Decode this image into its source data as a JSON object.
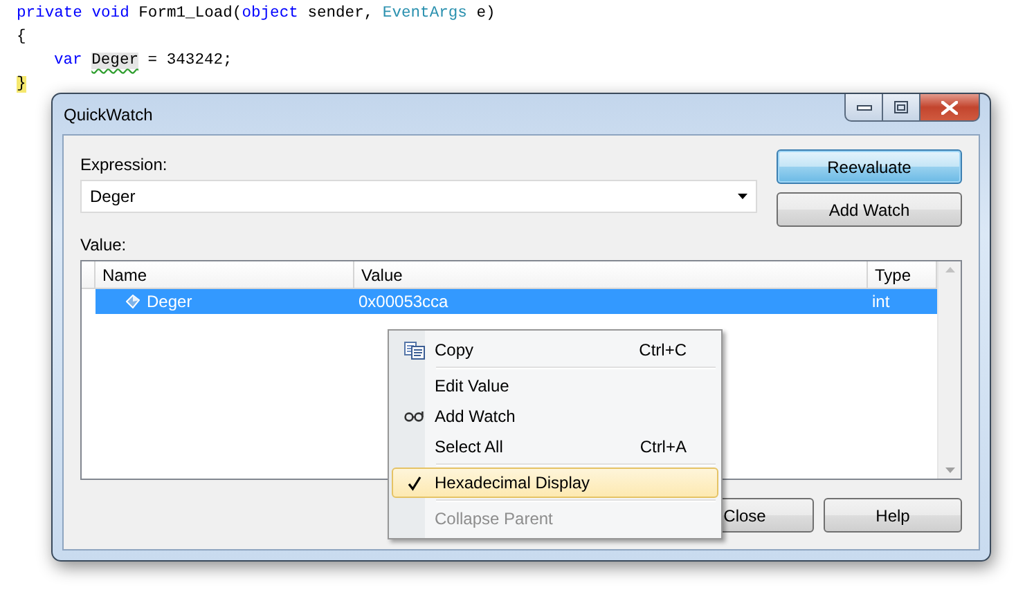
{
  "editor": {
    "lines": [
      {
        "tokens": [
          {
            "kind": "keyword",
            "text": "private "
          },
          {
            "kind": "keyword",
            "text": "void "
          },
          {
            "kind": "plain",
            "text": "Form1_Load("
          },
          {
            "kind": "keyword",
            "text": "object "
          },
          {
            "kind": "plain",
            "text": "sender, "
          },
          {
            "kind": "type",
            "text": "EventArgs "
          },
          {
            "kind": "plain",
            "text": "e)"
          }
        ]
      },
      {
        "tokens": [
          {
            "kind": "plain",
            "text": "{"
          }
        ]
      },
      {
        "indented": true,
        "tokens": [
          {
            "kind": "keyword",
            "text": "var "
          },
          {
            "kind": "warning",
            "text": "Deger"
          },
          {
            "kind": "plain",
            "text": " = 343242;"
          }
        ]
      },
      {
        "tokens": [
          {
            "kind": "brace-match",
            "text": "}"
          }
        ]
      }
    ]
  },
  "dialog": {
    "title": "QuickWatch",
    "expression": {
      "label": "Expression:",
      "value": "Deger"
    },
    "buttons": [
      {
        "label": "Reevaluate",
        "default": true
      },
      {
        "label": "Add Watch",
        "default": false
      }
    ],
    "value_label": "Value:",
    "grid": {
      "columns": [
        "Name",
        "Value",
        "Type"
      ],
      "rows": [
        {
          "name": "Deger",
          "value": "0x00053cca",
          "type": "int",
          "selected": true
        }
      ]
    },
    "footer_buttons": [
      "Close",
      "Help"
    ]
  },
  "context_menu": {
    "items": [
      {
        "kind": "copy-item",
        "label": "Copy",
        "shortcut": "Ctrl+C",
        "checked": false,
        "selected": false,
        "disabled": false
      },
      {
        "kind": "separator"
      },
      {
        "kind": "item",
        "label": "Edit Value",
        "checked": false,
        "selected": false,
        "disabled": false
      },
      {
        "kind": "watch-item",
        "label": "Add Watch",
        "checked": false,
        "selected": false,
        "disabled": false
      },
      {
        "kind": "item",
        "label": "Select All",
        "shortcut": "Ctrl+A",
        "checked": false,
        "selected": false,
        "disabled": false
      },
      {
        "kind": "separator"
      },
      {
        "kind": "item",
        "label": "Hexadecimal Display",
        "checked": true,
        "selected": true,
        "disabled": false
      },
      {
        "kind": "separator"
      },
      {
        "kind": "item",
        "label": "Collapse Parent",
        "checked": false,
        "selected": false,
        "disabled": true
      }
    ]
  }
}
